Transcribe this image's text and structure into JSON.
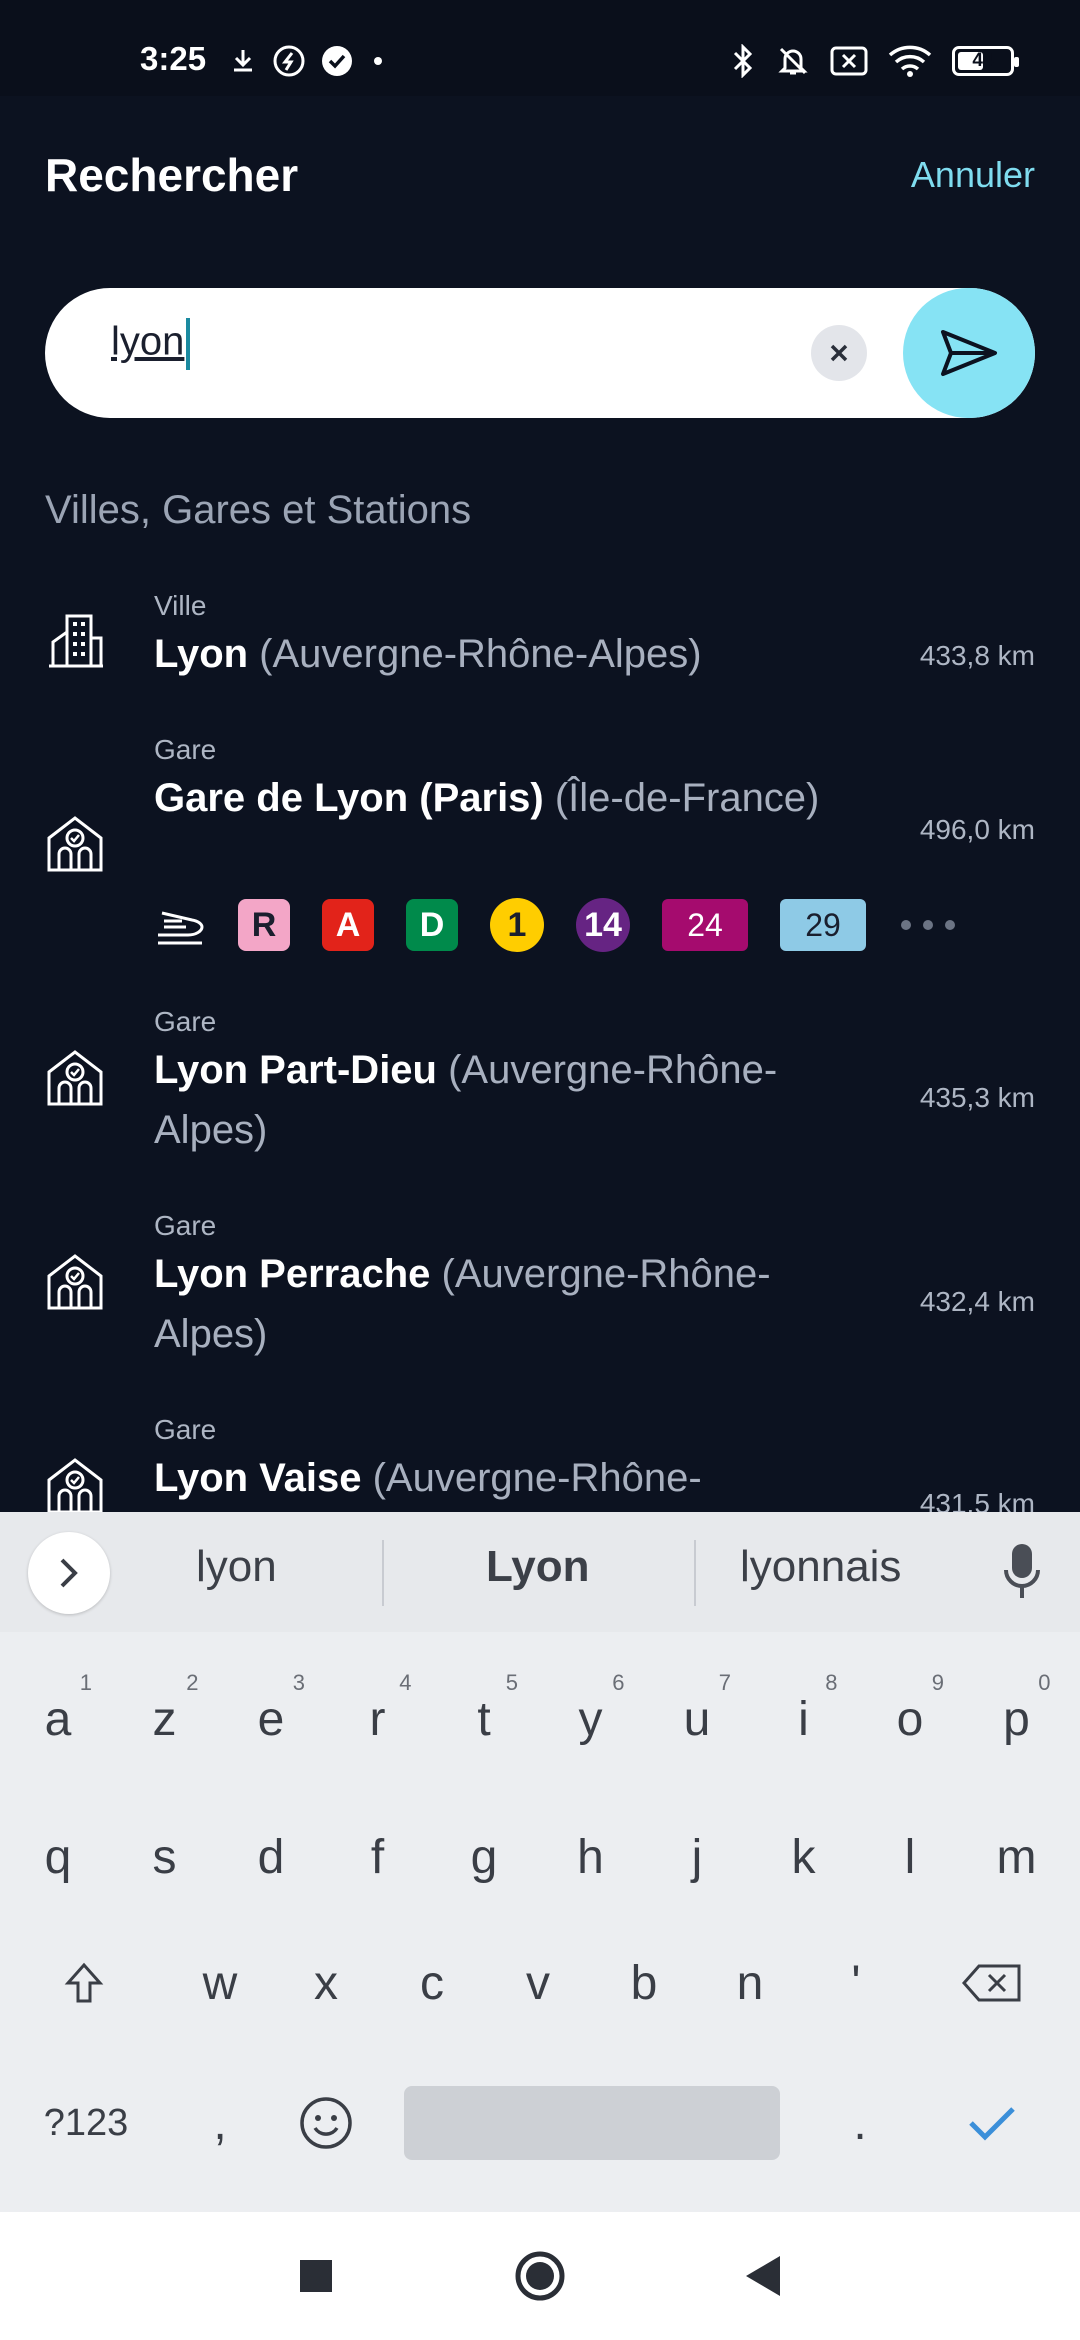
{
  "status_bar": {
    "time": "3:25",
    "battery": "44",
    "icons_left": [
      "download-icon",
      "shazam-icon",
      "check-circle-icon",
      "dot-icon"
    ],
    "icons_right": [
      "bluetooth-icon",
      "bell-off-icon",
      "sim-x-icon",
      "wifi-icon",
      "battery-icon"
    ]
  },
  "header": {
    "title": "Rechercher",
    "cancel_label": "Annuler"
  },
  "search": {
    "value": "lyon"
  },
  "section_title": "Villes, Gares et Stations",
  "results": [
    {
      "type": "Ville",
      "name": "Lyon",
      "region": " (Auvergne-Rhône-Alpes)",
      "distance": "433,8 km",
      "icon": "city-icon"
    },
    {
      "type": "Gare",
      "name": "Gare de Lyon (Paris)",
      "region": " (Île-de-France)",
      "distance": "496,0 km",
      "icon": "station-icon",
      "lines": [
        {
          "label": "R",
          "shape": "sq",
          "bg": "#f3a6c7",
          "fg": "#1a1f2e"
        },
        {
          "label": "A",
          "shape": "sq",
          "bg": "#e2231a",
          "fg": "#ffffff"
        },
        {
          "label": "D",
          "shape": "sq",
          "bg": "#008a4b",
          "fg": "#ffffff"
        },
        {
          "label": "1",
          "shape": "circ",
          "bg": "#ffcd00",
          "fg": "#1a1f2e"
        },
        {
          "label": "14",
          "shape": "circ",
          "bg": "#662483",
          "fg": "#ffffff"
        },
        {
          "label": "24",
          "shape": "rect",
          "bg": "#a50b6e",
          "fg": "#ffffff"
        },
        {
          "label": "29",
          "shape": "rect",
          "bg": "#8ecae6",
          "fg": "#1a1f2e"
        }
      ]
    },
    {
      "type": "Gare",
      "name": "Lyon Part-Dieu",
      "region": " (Auvergne-Rhône-Alpes)",
      "distance": "435,3 km",
      "icon": "station-icon"
    },
    {
      "type": "Gare",
      "name": "Lyon Perrache",
      "region": " (Auvergne-Rhône-Alpes)",
      "distance": "432,4 km",
      "icon": "station-icon"
    },
    {
      "type": "Gare",
      "name": "Lyon Vaise",
      "region": " (Auvergne-Rhône-",
      "distance": "431,5 km",
      "icon": "station-icon"
    }
  ],
  "keyboard": {
    "suggestions": [
      "lyon",
      "Lyon",
      "lyonnais"
    ],
    "row1": [
      "a",
      "z",
      "e",
      "r",
      "t",
      "y",
      "u",
      "i",
      "o",
      "p"
    ],
    "row1_nums": [
      "1",
      "2",
      "3",
      "4",
      "5",
      "6",
      "7",
      "8",
      "9",
      "0"
    ],
    "row2": [
      "q",
      "s",
      "d",
      "f",
      "g",
      "h",
      "j",
      "k",
      "l",
      "m"
    ],
    "row3": [
      "w",
      "x",
      "c",
      "v",
      "b",
      "n",
      "'"
    ],
    "symbols_label": "?123",
    "comma": ",",
    "period": "."
  },
  "colors": {
    "background": "#0c1220",
    "accent": "#7fdcef",
    "send_button": "#86e3f4"
  }
}
